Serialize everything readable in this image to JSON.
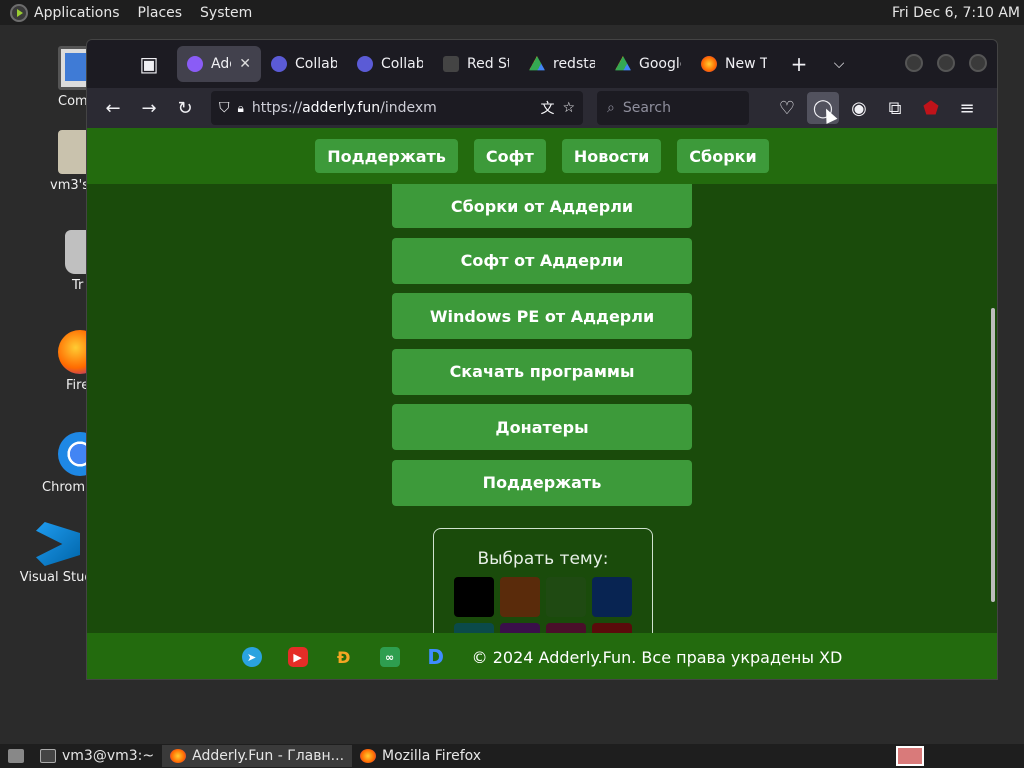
{
  "top_panel": {
    "menus": [
      "Applications",
      "Places",
      "System"
    ],
    "clock": "Fri Dec  6,  7:10 AM"
  },
  "desktop_icons": [
    {
      "label": "Com",
      "icon": "computer-icon"
    },
    {
      "label": "vm3's",
      "icon": "home-folder-icon"
    },
    {
      "label": "Tr",
      "icon": "trash-icon"
    },
    {
      "label": "Fire",
      "icon": "firefox-icon"
    },
    {
      "label": "Chromi",
      "icon": "chromium-icon"
    },
    {
      "label": "Visual Studi",
      "icon": "vscode-icon"
    }
  ],
  "browser": {
    "tabs": [
      {
        "title": "Add",
        "active": true,
        "color": "#8a5cf6"
      },
      {
        "title": "Collab",
        "active": false,
        "color": "#5b5bd6"
      },
      {
        "title": "Collab",
        "active": false,
        "color": "#5b5bd6"
      },
      {
        "title": "Red St",
        "active": false,
        "color": "#444444"
      },
      {
        "title": "redsta",
        "active": false,
        "color": "#34a853"
      },
      {
        "title": "Google",
        "active": false,
        "color": "#34a853"
      },
      {
        "title": "New T",
        "active": false,
        "color": "#ff7139"
      }
    ],
    "url_prefix": "https://",
    "url_domain": "adderly.fun",
    "url_path": "/indexm",
    "search_placeholder": "Search"
  },
  "site": {
    "header_buttons": [
      "Поддержать",
      "Софт",
      "Новости",
      "Сборки"
    ],
    "menu_buttons": [
      "Сборки от Аддерли",
      "Софт от Аддерли",
      "Windows PE от Аддерли",
      "Скачать программы",
      "Донатеры",
      "Поддержать"
    ],
    "theme_title": "Выбрать тему:",
    "theme_colors": [
      "#000000",
      "#5a2b0b",
      "#1f4a12",
      "#082452",
      "#0b4a4a",
      "#3a0f4a",
      "#4a0f2a",
      "#5a0b0b"
    ],
    "footer_text": "© 2024 Adderly.Fun. Все права украдены XD",
    "colors": {
      "header": "#236b0e",
      "background": "#1a4b0b",
      "button": "#3d9a3a"
    }
  },
  "taskbar": {
    "items": [
      "vm3@vm3:~",
      "Adderly.Fun - Главн...",
      "Mozilla Firefox"
    ]
  }
}
